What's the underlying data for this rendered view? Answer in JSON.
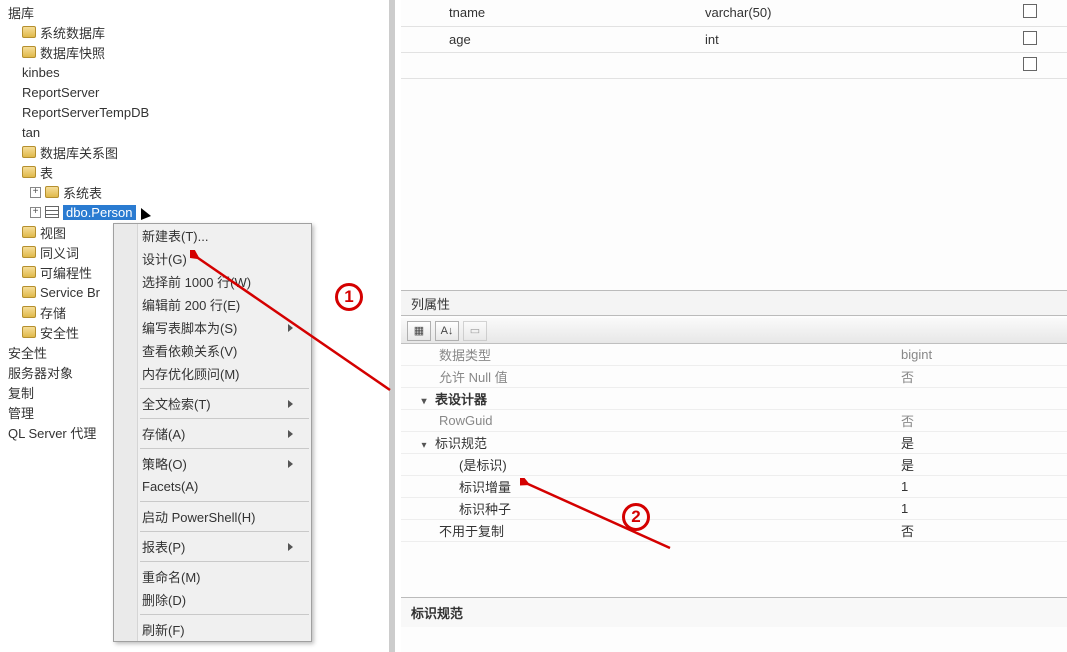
{
  "tree": {
    "root": "据库",
    "sys_db": "系统数据库",
    "snap": "数据库快照",
    "kinbes": "kinbes",
    "reportserver": "ReportServer",
    "reportservertemp": "ReportServerTempDB",
    "tan": "tan",
    "rel_diagram": "数据库关系图",
    "tables": "表",
    "systables": "系统表",
    "dboPerson": "dbo.Person",
    "views": "视图",
    "synonyms": "同义词",
    "program": "可编程性",
    "servicebr": "Service Br",
    "storage": "存储",
    "security": "安全性",
    "sec2": "安全性",
    "serverobj": "服务器对象",
    "repl": "复制",
    "mgmt": "管理",
    "agent": "QL Server 代理"
  },
  "context_menu": {
    "new_table": "新建表(T)...",
    "design": "设计(G)",
    "select1000": "选择前 1000 行(W)",
    "edit200": "编辑前 200 行(E)",
    "script_as": "编写表脚本为(S)",
    "dependencies": "查看依赖关系(V)",
    "memopt": "内存优化顾问(M)",
    "fulltext": "全文检索(T)",
    "storage": "存储(A)",
    "policy": "策略(O)",
    "facets": "Facets(A)",
    "powershell": "启动 PowerShell(H)",
    "reports": "报表(P)",
    "rename": "重命名(M)",
    "delete": "删除(D)",
    "refresh": "刷新(F)"
  },
  "columns": {
    "row1_name": "tname",
    "row1_type": "varchar(50)",
    "row2_name": "age",
    "row2_type": "int"
  },
  "props_header": "列属性",
  "props": {
    "datatype_label": "数据类型",
    "datatype_val": "bigint",
    "nullable_label": "允许 Null 值",
    "nullable_val": "否",
    "tabledesign": "表设计器",
    "rowguid_label": "RowGuid",
    "rowguid_val": "否",
    "identspec_label": "标识规范",
    "identspec_val": "是",
    "isident_label": "(是标识)",
    "isident_val": "是",
    "identincr_label": "标识增量",
    "identincr_val": "1",
    "identseed_label": "标识种子",
    "identseed_val": "1",
    "notforrepl_label": "不用于复制",
    "notforrepl_val": "否"
  },
  "props_footer": "标识规范",
  "annotations": {
    "a1": "1",
    "a2": "2"
  }
}
